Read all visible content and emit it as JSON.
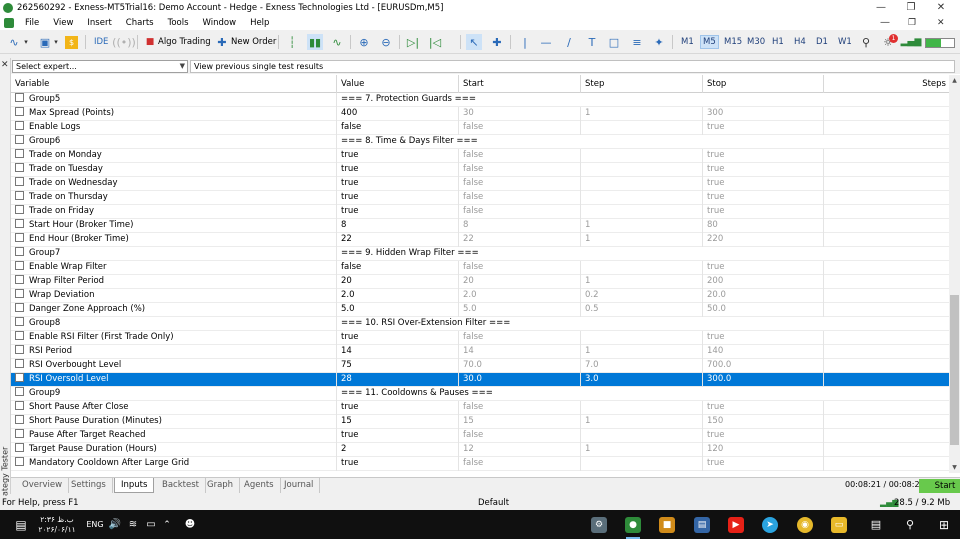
{
  "window": {
    "title": "262560292 - Exness-MT5Trial16: Demo Account - Hedge - Exness Technologies Ltd - [EURUSDm,M5]"
  },
  "menu": [
    "File",
    "View",
    "Insert",
    "Charts",
    "Tools",
    "Window",
    "Help"
  ],
  "toolbar": {
    "ide_label": "IDE",
    "algo_trading_label": "Algo Trading",
    "new_order_label": "New Order",
    "timeframes": [
      "M1",
      "M5",
      "M15",
      "M30",
      "H1",
      "H4",
      "D1",
      "W1"
    ],
    "active_timeframe": "M5",
    "notification_count": "1"
  },
  "tester": {
    "side_label": "Strategy Tester",
    "expert_select": "Select expert...",
    "results_select": "View previous single test results",
    "columns": [
      "Variable",
      "Value",
      "Start",
      "Step",
      "Stop",
      "Steps"
    ],
    "rows": [
      {
        "variable": "Group5",
        "value": "=== 7. Protection Guards ===",
        "start": "",
        "step": "",
        "stop": ""
      },
      {
        "variable": "Max Spread (Points)",
        "value": "400",
        "start": "30",
        "step": "1",
        "stop": "300"
      },
      {
        "variable": "Enable Logs",
        "value": "false",
        "start": "false",
        "step": "",
        "stop": "true"
      },
      {
        "variable": "Group6",
        "value": "=== 8. Time & Days Filter ===",
        "start": "",
        "step": "",
        "stop": ""
      },
      {
        "variable": "Trade on Monday",
        "value": "true",
        "start": "false",
        "step": "",
        "stop": "true"
      },
      {
        "variable": "Trade on Tuesday",
        "value": "true",
        "start": "false",
        "step": "",
        "stop": "true"
      },
      {
        "variable": "Trade on Wednesday",
        "value": "true",
        "start": "false",
        "step": "",
        "stop": "true"
      },
      {
        "variable": "Trade on Thursday",
        "value": "true",
        "start": "false",
        "step": "",
        "stop": "true"
      },
      {
        "variable": "Trade on Friday",
        "value": "true",
        "start": "false",
        "step": "",
        "stop": "true"
      },
      {
        "variable": "Start Hour (Broker Time)",
        "value": "8",
        "start": "8",
        "step": "1",
        "stop": "80"
      },
      {
        "variable": "End Hour (Broker Time)",
        "value": "22",
        "start": "22",
        "step": "1",
        "stop": "220"
      },
      {
        "variable": "Group7",
        "value": "=== 9. Hidden Wrap Filter ===",
        "start": "",
        "step": "",
        "stop": ""
      },
      {
        "variable": "Enable Wrap Filter",
        "value": "false",
        "start": "false",
        "step": "",
        "stop": "true"
      },
      {
        "variable": "Wrap Filter Period",
        "value": "20",
        "start": "20",
        "step": "1",
        "stop": "200"
      },
      {
        "variable": "Wrap Deviation",
        "value": "2.0",
        "start": "2.0",
        "step": "0.2",
        "stop": "20.0"
      },
      {
        "variable": "Danger Zone Approach (%)",
        "value": "5.0",
        "start": "5.0",
        "step": "0.5",
        "stop": "50.0"
      },
      {
        "variable": "Group8",
        "value": "=== 10. RSI Over-Extension Filter ===",
        "start": "",
        "step": "",
        "stop": ""
      },
      {
        "variable": "Enable RSI Filter (First Trade Only)",
        "value": "true",
        "start": "false",
        "step": "",
        "stop": "true"
      },
      {
        "variable": "RSI Period",
        "value": "14",
        "start": "14",
        "step": "1",
        "stop": "140"
      },
      {
        "variable": "RSI Overbought Level",
        "value": "75",
        "start": "70.0",
        "step": "7.0",
        "stop": "700.0"
      },
      {
        "variable": "RSI Oversold Level",
        "value": "28",
        "start": "30.0",
        "step": "3.0",
        "stop": "300.0",
        "selected": true
      },
      {
        "variable": "Group9",
        "value": "=== 11. Cooldowns & Pauses ===",
        "start": "",
        "step": "",
        "stop": ""
      },
      {
        "variable": "Short Pause After Close",
        "value": "true",
        "start": "false",
        "step": "",
        "stop": "true"
      },
      {
        "variable": "Short Pause Duration (Minutes)",
        "value": "15",
        "start": "15",
        "step": "1",
        "stop": "150"
      },
      {
        "variable": "Pause After Target Reached",
        "value": "true",
        "start": "false",
        "step": "",
        "stop": "true"
      },
      {
        "variable": "Target Pause Duration (Hours)",
        "value": "2",
        "start": "12",
        "step": "1",
        "stop": "120"
      },
      {
        "variable": "Mandatory Cooldown After Large Grid",
        "value": "true",
        "start": "false",
        "step": "",
        "stop": "true"
      }
    ],
    "tabs": [
      "Overview",
      "Settings",
      "Inputs",
      "Backtest",
      "Graph",
      "Agents",
      "Journal"
    ],
    "active_tab": "Inputs",
    "timer": "00:08:21 / 00:08:21",
    "start_label": "Start"
  },
  "statusbar": {
    "help": "For Help, press F1",
    "profile": "Default",
    "traffic": "28.5 / 9.2 Mb"
  },
  "taskbar": {
    "clock_time": "۲:۳۶ ب.ظ",
    "clock_date": "۲۰۲۶/۰۶/۱۱",
    "lang": "ENG"
  },
  "colors": {
    "selection": "#0078d7",
    "start_button": "#68c94c",
    "accent": "#2e8b3a"
  }
}
